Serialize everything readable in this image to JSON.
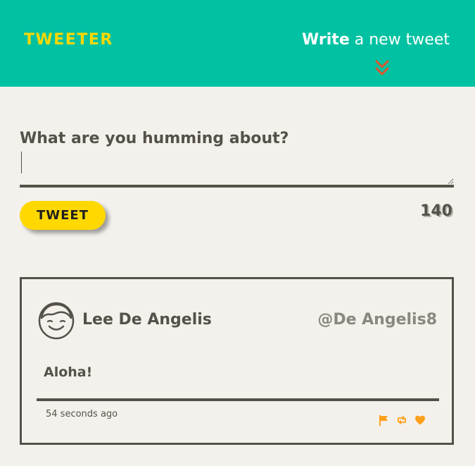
{
  "header": {
    "logo": "TWEETER",
    "compose_toggle_bold": "Write",
    "compose_toggle_rest": " a new tweet",
    "chevron_icon": "double-chevron-down-icon",
    "colors": {
      "background": "#00c2a2",
      "logo": "#ffd800",
      "chevron": "#e0542b"
    }
  },
  "compose": {
    "label": "What are you humming about?",
    "input_value": "",
    "button_label": "Tweet",
    "char_counter": "140",
    "colors": {
      "button": "#ffd800"
    }
  },
  "tweets": [
    {
      "avatar_icon": "user-face-icon",
      "author_name": "Lee De Angelis",
      "handle": "@De Angelis8",
      "text": "Aloha!",
      "timestamp": "54 seconds ago",
      "actions": [
        "flag-icon",
        "retweet-icon",
        "heart-icon"
      ],
      "action_color": "#ff9f1a"
    }
  ]
}
